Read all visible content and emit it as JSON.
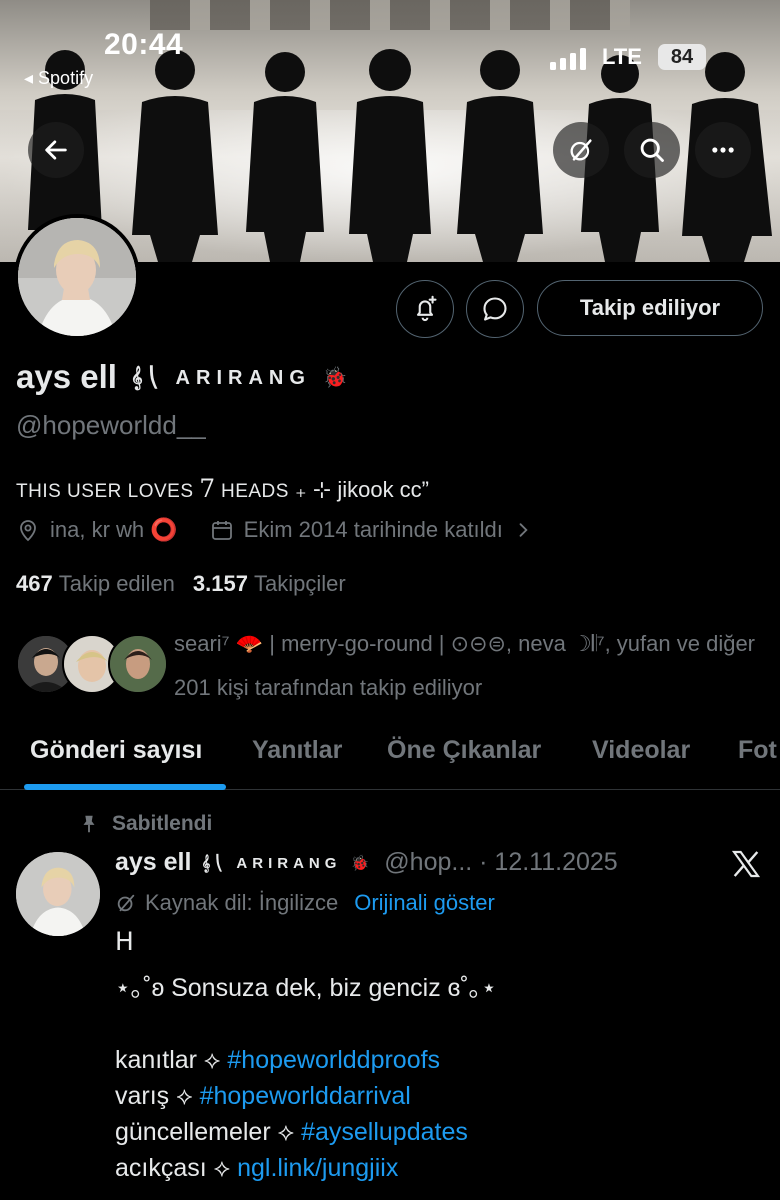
{
  "status_bar": {
    "time": "20:44",
    "back_app": "◂ Spotify",
    "network": "LTE",
    "battery": "84"
  },
  "profile": {
    "name": "ays ell",
    "name_extra": "𝄞⎝ ARIRANG 🐞",
    "handle": "@hopeworldd__",
    "bio_caps": "THIS USER LOVES ",
    "bio_seven": "7",
    "bio_caps2": " HEADS",
    "bio_rest": " ₊ ⊹ jikook cc”",
    "location": "ina, kr wh ⭕",
    "joined": "Ekim 2014 tarihinde katıldı",
    "following_count": "467",
    "following_label": "Takip edilen",
    "followers_count": "3.157",
    "followers_label": "Takipçiler",
    "followed_by": "seari⁷ 🪭 | merry-go-round | ⊙⊝⊜, neva ☽𝄃⁷, yufan ve diğer 201 kişi tarafından takip ediliyor",
    "follow_button": "Takip ediliyor"
  },
  "tabs": [
    {
      "label": "Gönderi sayısı",
      "active": true
    },
    {
      "label": "Yanıtlar"
    },
    {
      "label": "Öne Çıkanlar"
    },
    {
      "label": "Videolar"
    },
    {
      "label": "Fot"
    }
  ],
  "post": {
    "pinned_label": "Sabitlendi",
    "name": "ays ell",
    "name_extra": "𝄞⎝ ARIRANG 🐞",
    "handle_date": "@hop... · 12.11.2025",
    "source_lang": "Kaynak dil: İngilizce",
    "show_original": "Orijinali göster",
    "line1": "ᕼ",
    "line2": "⋆｡˚ʚ Sonsuza dek, biz genciz ɞ˚｡⋆",
    "rows": [
      {
        "label": "kanıtlar ⟡ ",
        "tag": "#hopeworlddproofs"
      },
      {
        "label": "varış ⟡ ",
        "tag": "#hopeworlddarrival"
      },
      {
        "label": "güncellemeler ⟡ ",
        "tag": "#aysellupdates"
      },
      {
        "label": "acıkçası ⟡ ",
        "tag": "ngl.link/jungjiix"
      }
    ]
  },
  "colors": {
    "accent": "#1d9bf0",
    "muted": "#71767b",
    "text": "#e7e9ea",
    "bg": "#000000"
  }
}
